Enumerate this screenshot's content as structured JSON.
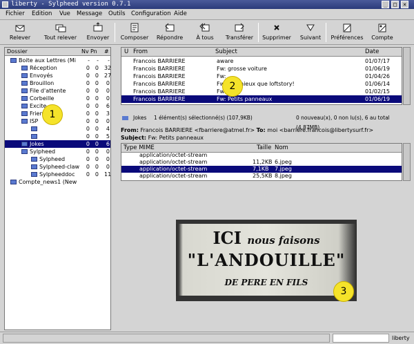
{
  "window": {
    "title": "liberty - Sylpheed version 0.7.1"
  },
  "menu": [
    "Fichier",
    "Edition",
    "Vue",
    "Message",
    "Outils",
    "Configuration",
    "Aide"
  ],
  "toolbar": [
    {
      "label": "Relever",
      "icon": "get-mail-icon"
    },
    {
      "label": "Tout relever",
      "icon": "get-all-icon"
    },
    {
      "label": "Envoyer",
      "icon": "send-icon"
    },
    {
      "label": "Composer",
      "icon": "compose-icon"
    },
    {
      "label": "Répondre",
      "icon": "reply-icon"
    },
    {
      "label": "À tous",
      "icon": "reply-all-icon"
    },
    {
      "label": "Transférer",
      "icon": "forward-icon"
    },
    {
      "label": "Supprimer",
      "icon": "delete-icon"
    },
    {
      "label": "Suivant",
      "icon": "next-icon"
    },
    {
      "label": "Préférences",
      "icon": "prefs-icon"
    },
    {
      "label": "Compte",
      "icon": "account-icon"
    }
  ],
  "folders": {
    "headers": [
      "Dossier",
      "Nv",
      "Pn",
      "#"
    ],
    "rows": [
      {
        "name": "Boite aux Lettres (Mi",
        "n": "-",
        "p": "-",
        "t": "-"
      },
      {
        "name": "Réception",
        "n": "0",
        "p": "0",
        "t": "32"
      },
      {
        "name": "Envoyés",
        "n": "0",
        "p": "0",
        "t": "27"
      },
      {
        "name": "Brouillon",
        "n": "0",
        "p": "0",
        "t": "0"
      },
      {
        "name": "File d'attente",
        "n": "0",
        "p": "0",
        "t": "0"
      },
      {
        "name": "Corbeille",
        "n": "0",
        "p": "0",
        "t": "0"
      },
      {
        "name": "Excite",
        "n": "0",
        "p": "0",
        "t": "6"
      },
      {
        "name": "Friends",
        "n": "0",
        "p": "0",
        "t": "3"
      },
      {
        "name": "ISP",
        "n": "0",
        "p": "0",
        "t": "0"
      },
      {
        "name": "",
        "n": "0",
        "p": "0",
        "t": "4"
      },
      {
        "name": "",
        "n": "0",
        "p": "0",
        "t": "5"
      },
      {
        "name": "Jokes",
        "n": "0",
        "p": "0",
        "t": "6"
      },
      {
        "name": "Sylpheed",
        "n": "0",
        "p": "0",
        "t": "0"
      },
      {
        "name": "Sylpheed",
        "n": "0",
        "p": "0",
        "t": "0"
      },
      {
        "name": "Sylpheed-claw",
        "n": "0",
        "p": "0",
        "t": "0"
      },
      {
        "name": "Sylpheeddoc",
        "n": "0",
        "p": "0",
        "t": "11"
      },
      {
        "name": "Compte_news1 (New",
        "n": "",
        "p": "",
        "t": ""
      }
    ]
  },
  "messages": {
    "headers": [
      "U",
      "From",
      "Subject",
      "Date"
    ],
    "rows": [
      {
        "from": "Francois BARRIERE",
        "subject": "aware",
        "date": "01/07/17"
      },
      {
        "from": "Francois BARRIERE",
        "subject": "Fw: grosse voiture",
        "date": "01/06/19"
      },
      {
        "from": "Francois BARRIERE",
        "subject": "Fw:",
        "date": "01/04/26"
      },
      {
        "from": "Francois BARRIERE",
        "subject": "Fw:  ore mieux que loftstory!",
        "date": "01/06/14"
      },
      {
        "from": "Francois BARRIERE",
        "subject": "Fw:",
        "date": "01/02/15"
      },
      {
        "from": "Francois BARRIERE",
        "subject": "Fw: Petits panneaux",
        "date": "01/06/19"
      }
    ]
  },
  "folder_status": {
    "name": "Jokes",
    "selection": "1 élément(s) sélectionné(s) (107,9KB)",
    "counts": "0 nouveau(x), 0 non lu(s), 6 au total (4,87MB)"
  },
  "header_info": {
    "from_label": "From:",
    "from": "Francois BARRIERE <fbarriere@atmel.fr>",
    "to_label": "To:",
    "to": "moi <barriere.francois@libertysurf.fr>",
    "subject_label": "Subject:",
    "subject": "Fw: Petits panneaux"
  },
  "attachments": {
    "headers": [
      "Type MIME",
      "Taille",
      "Nom"
    ],
    "rows": [
      {
        "type": "application/octet-stream",
        "size": "",
        "name": ""
      },
      {
        "type": "application/octet-stream",
        "size": "11,2KB",
        "name": "6.jpeg"
      },
      {
        "type": "application/octet-stream",
        "size": "7,1KB",
        "name": "7.jpeg"
      },
      {
        "type": "application/octet-stream",
        "size": "25,5KB",
        "name": "8.jpeg"
      }
    ]
  },
  "image_sign": {
    "line1a": "ICI",
    "line1b": "nous faisons",
    "line2": "\"L'ANDOUILLE\"",
    "line3": "DE PERE EN FILS"
  },
  "badges": [
    "1",
    "2",
    "3"
  ],
  "statusbar": {
    "right": "liberty"
  }
}
